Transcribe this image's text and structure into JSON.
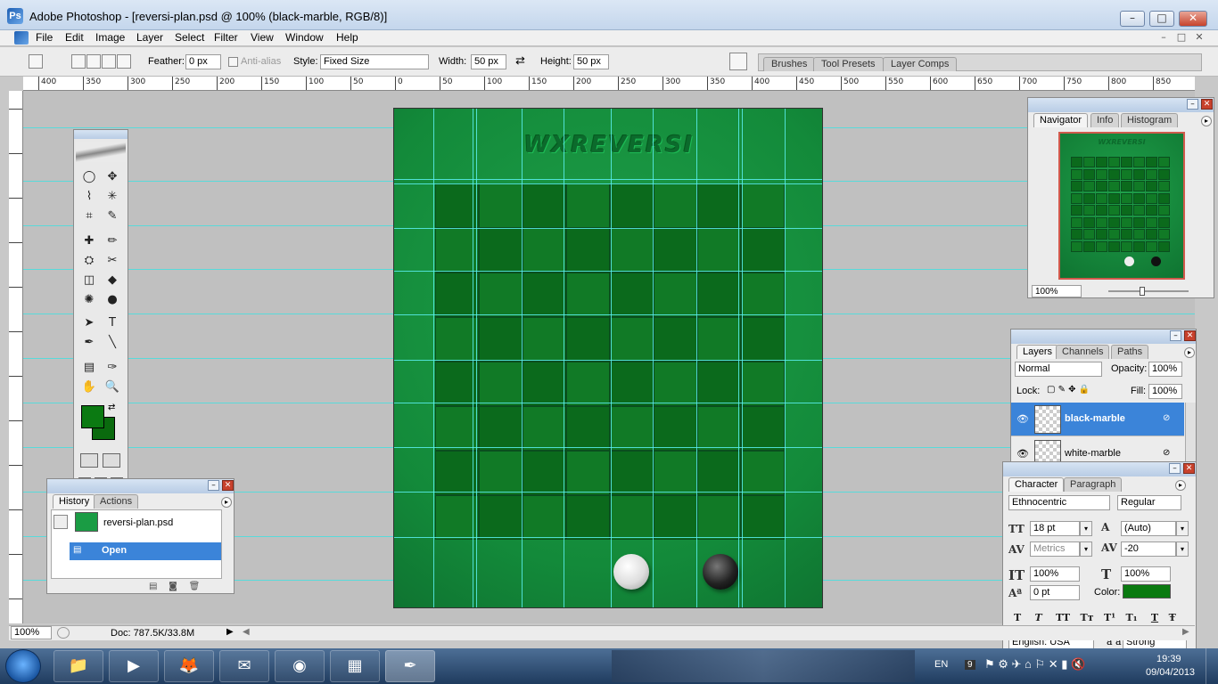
{
  "window": {
    "title": "Adobe Photoshop - [reversi-plan.psd @ 100% (black-marble, RGB/8)]",
    "logo_text": "Ps",
    "min_glyph": "–",
    "max_glyph": "□",
    "close_glyph": "✕"
  },
  "menu": {
    "items": [
      "File",
      "Edit",
      "Image",
      "Layer",
      "Select",
      "Filter",
      "View",
      "Window",
      "Help"
    ]
  },
  "options": {
    "feather_label": "Feather:",
    "feather_value": "0 px",
    "antialias_label": "Anti-alias",
    "style_label": "Style:",
    "style_value": "Fixed Size",
    "width_label": "Width:",
    "width_value": "50 px",
    "swap_glyph": "⇄",
    "height_label": "Height:",
    "height_value": "50 px"
  },
  "palette_well": {
    "tabs": [
      "Brushes",
      "Tool Presets",
      "Layer Comps"
    ]
  },
  "ruler": {
    "labels": [
      "400",
      "350",
      "300",
      "250",
      "200",
      "150",
      "100",
      "50",
      "0",
      "50",
      "100",
      "150",
      "200",
      "250",
      "300",
      "350",
      "400",
      "450",
      "500",
      "550",
      "600",
      "650",
      "700",
      "750",
      "800",
      "850"
    ]
  },
  "canvas": {
    "logo_text": "WXREVERSI"
  },
  "toolbox": {
    "tools": [
      "◯",
      "✥",
      "⌇",
      "✳",
      "⌗",
      "✎",
      "✚",
      "✏",
      "⛭",
      "✂",
      "◫",
      "◆",
      "✺",
      "●",
      "➤",
      "T",
      "✒",
      "╲",
      "▤",
      "✑",
      "✋",
      "🔍"
    ]
  },
  "history": {
    "tab_history": "History",
    "tab_actions": "Actions",
    "snapshot_name": "reversi-plan.psd",
    "step_name": "Open"
  },
  "navigator": {
    "tab_navigator": "Navigator",
    "tab_info": "Info",
    "tab_histogram": "Histogram",
    "zoom": "100%",
    "thumb_text": "WXREVERSI"
  },
  "layers": {
    "tab_layers": "Layers",
    "tab_channels": "Channels",
    "tab_paths": "Paths",
    "blend_mode": "Normal",
    "opacity_label": "Opacity:",
    "opacity_value": "100%",
    "lock_label": "Lock:",
    "fill_label": "Fill:",
    "fill_value": "100%",
    "rows": [
      {
        "name": "black-marble",
        "selected": true
      },
      {
        "name": "white-marble",
        "selected": false
      }
    ]
  },
  "character": {
    "tab_character": "Character",
    "tab_paragraph": "Paragraph",
    "font_family": "Ethnocentric",
    "font_style": "Regular",
    "font_size": "18 pt",
    "leading": "(Auto)",
    "kerning": "Metrics",
    "tracking": "-20",
    "vscale": "100%",
    "hscale": "100%",
    "baseline": "0 pt",
    "color_label": "Color:",
    "text_color": "#0a7a10",
    "style_buttons": [
      "T",
      "T",
      "TT",
      "Tт",
      "T¹",
      "T₁",
      "T",
      "Ŧ"
    ],
    "language": "English: USA",
    "aa_label": "a a",
    "antialias": "Strong"
  },
  "status": {
    "zoom": "100%",
    "doc": "Doc: 787.5K/33.8M"
  },
  "taskbar": {
    "apps": [
      "📁",
      "▶",
      "🦊",
      "✉",
      "◉",
      "▦",
      "✒"
    ],
    "lang": "EN",
    "badge": "9",
    "time": "19:39",
    "date": "09/04/2013"
  },
  "colors": {
    "foreground": "#0b7a12",
    "background": "#0a6a0e",
    "selection": "#3b84d9",
    "guide": "#3fe0e0"
  }
}
